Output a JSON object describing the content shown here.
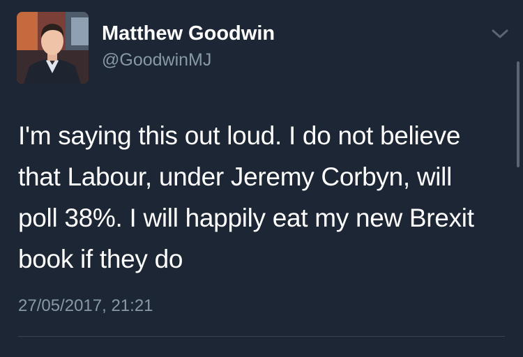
{
  "author": {
    "display_name": "Matthew Goodwin",
    "handle": "@GoodwinMJ",
    "avatar_icon": "profile-photo"
  },
  "tweet": {
    "text": "I'm saying this out loud. I do not believe\nthat Labour, under Jeremy Corbyn, will\npoll 38%. I will happily eat my new Brexit\nbook if they do",
    "timestamp": "27/05/2017, 21:21"
  },
  "icons": {
    "menu": "chevron-down-icon"
  },
  "colors": {
    "background": "#1c2634",
    "primary_text": "#ffffff",
    "secondary_text": "#8899a6",
    "divider": "#38444d"
  }
}
